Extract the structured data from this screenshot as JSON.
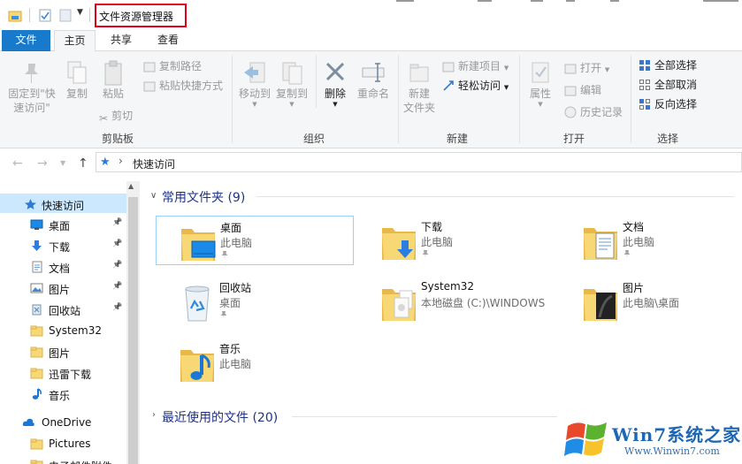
{
  "window": {
    "title": "文件资源管理器"
  },
  "tabs": [
    "文件",
    "主页",
    "共享",
    "查看"
  ],
  "ribbon": {
    "clipboard": {
      "label": "剪贴板",
      "pin": "固定到\"快\n速访问\"",
      "copy": "复制",
      "paste": "粘贴",
      "copy_path": "复制路径",
      "paste_shortcut": "粘贴快捷方式",
      "cut": "剪切"
    },
    "organize": {
      "label": "组织",
      "move_to": "移动到",
      "copy_to": "复制到",
      "delete": "删除",
      "rename": "重命名"
    },
    "new": {
      "label": "新建",
      "new_folder": "新建\n文件夹",
      "new_item": "新建项目",
      "easy_access": "轻松访问"
    },
    "open": {
      "label": "打开",
      "properties": "属性",
      "open": "打开",
      "edit": "编辑",
      "history": "历史记录"
    },
    "select": {
      "label": "选择",
      "select_all": "全部选择",
      "select_none": "全部取消",
      "invert": "反向选择"
    }
  },
  "address": {
    "path": "快速访问"
  },
  "sidebar": {
    "items": [
      {
        "label": "快速访问",
        "icon": "star-icon",
        "pinned": false
      },
      {
        "label": "桌面",
        "icon": "desktop-icon",
        "pinned": true
      },
      {
        "label": "下载",
        "icon": "download-icon",
        "pinned": true
      },
      {
        "label": "文档",
        "icon": "document-icon",
        "pinned": true
      },
      {
        "label": "图片",
        "icon": "pictures-icon",
        "pinned": true
      },
      {
        "label": "回收站",
        "icon": "recycle-bin-icon",
        "pinned": true
      },
      {
        "label": "System32",
        "icon": "folder-icon",
        "pinned": false
      },
      {
        "label": "图片",
        "icon": "folder-icon",
        "pinned": false
      },
      {
        "label": "迅雷下载",
        "icon": "folder-icon",
        "pinned": false
      },
      {
        "label": "音乐",
        "icon": "music-icon",
        "pinned": false
      },
      {
        "label": "OneDrive",
        "icon": "cloud-icon",
        "pinned": false
      },
      {
        "label": "Pictures",
        "icon": "folder-icon",
        "pinned": false
      },
      {
        "label": "电子邮件附件",
        "icon": "folder-icon",
        "pinned": false
      }
    ]
  },
  "content": {
    "frequent_header": "常用文件夹 (9)",
    "recent_header": "最近使用的文件 (20)",
    "folders": [
      {
        "name": "桌面",
        "location": "此电脑",
        "pinned": true
      },
      {
        "name": "下载",
        "location": "此电脑",
        "pinned": true
      },
      {
        "name": "文档",
        "location": "此电脑",
        "pinned": true
      },
      {
        "name": "回收站",
        "location": "桌面",
        "pinned": true
      },
      {
        "name": "System32",
        "location": "本地磁盘 (C:)\\WINDOWS",
        "pinned": false
      },
      {
        "name": "图片",
        "location": "此电脑\\桌面",
        "pinned": false
      },
      {
        "name": "音乐",
        "location": "此电脑",
        "pinned": false
      }
    ]
  },
  "watermark": {
    "text": "Win7系统之家",
    "url": "Www.Winwin7.com"
  },
  "colors": {
    "accent": "#1979ca",
    "selection": "#cce8ff",
    "folder": "#f8d775",
    "highlight_box": "#e0001b"
  }
}
